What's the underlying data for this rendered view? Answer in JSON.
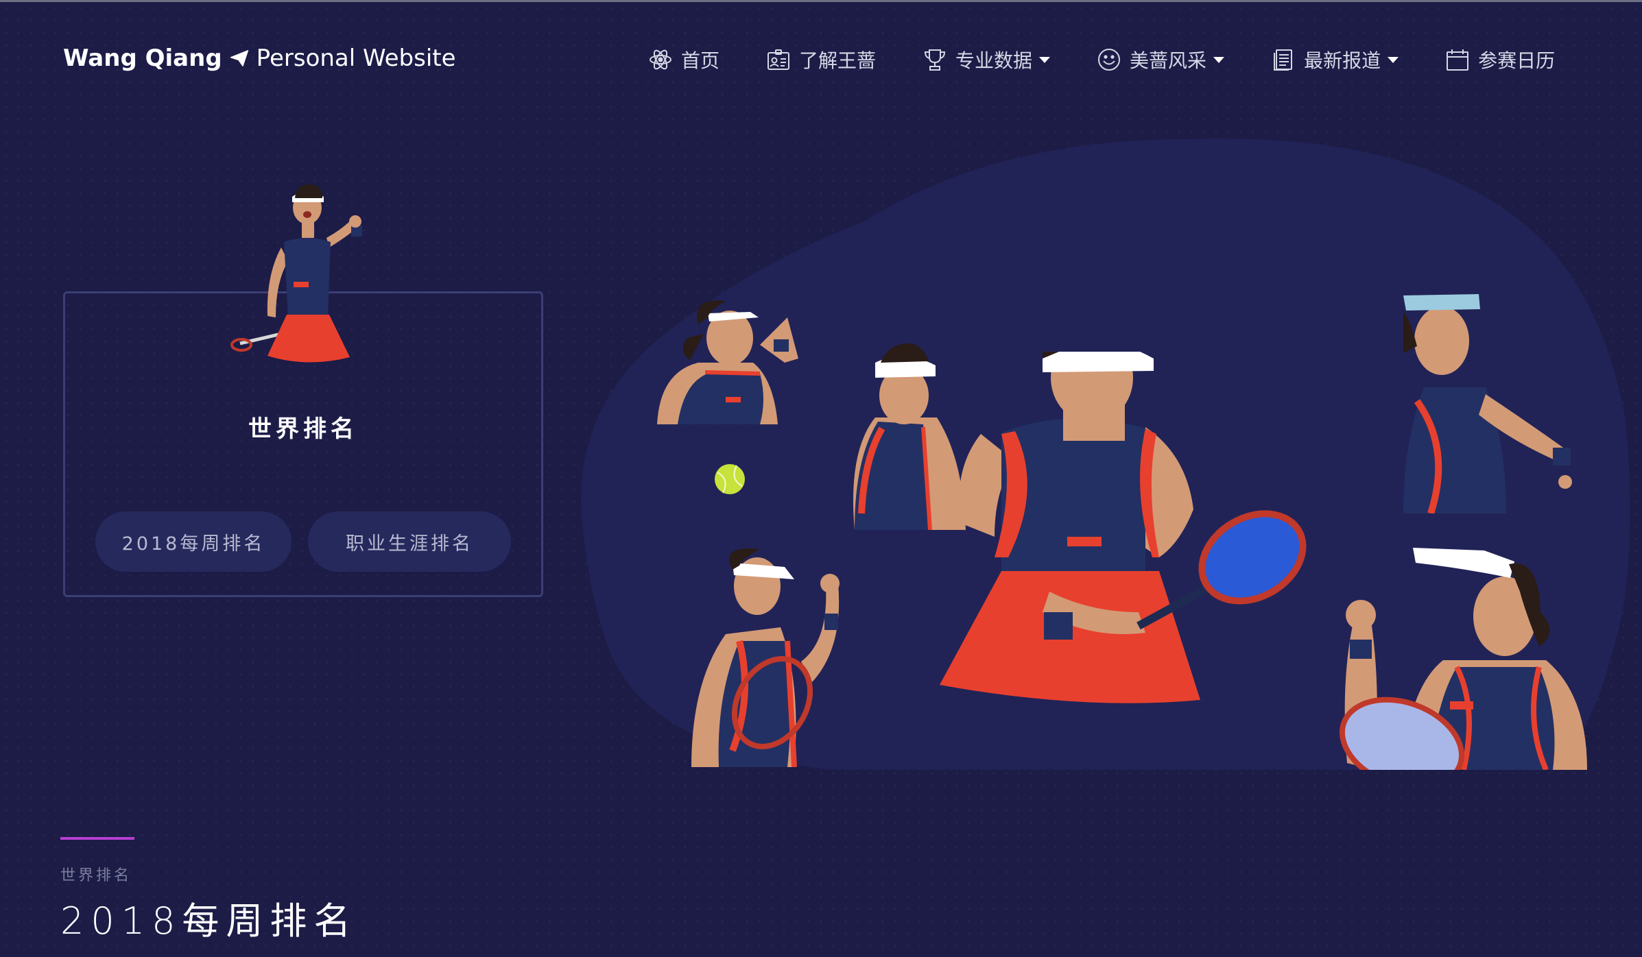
{
  "brand": {
    "bold": "Wang Qiang",
    "light": "Personal Website"
  },
  "nav": [
    {
      "label": "首页",
      "icon": "atom-icon"
    },
    {
      "label": "了解王蔷",
      "icon": "id-card-icon"
    },
    {
      "label": "专业数据",
      "icon": "trophy-icon",
      "dropdown": true
    },
    {
      "label": "美蔷风采",
      "icon": "smiley-icon",
      "dropdown": true
    },
    {
      "label": "最新报道",
      "icon": "document-icon",
      "dropdown": true
    },
    {
      "label": "参赛日历",
      "icon": "calendar-icon"
    }
  ],
  "card": {
    "title": "世界排名",
    "buttons": [
      "2018每周排名",
      "职业生涯排名"
    ]
  },
  "section": {
    "subtitle": "世界排名",
    "title": "2018每周排名"
  },
  "colors": {
    "background": "#1c1c47",
    "accent": "#b63fd1",
    "card_border": "#3b3f74",
    "button_bg": "#26295c",
    "navy_kit": "#233063",
    "red_kit": "#e8402e"
  }
}
